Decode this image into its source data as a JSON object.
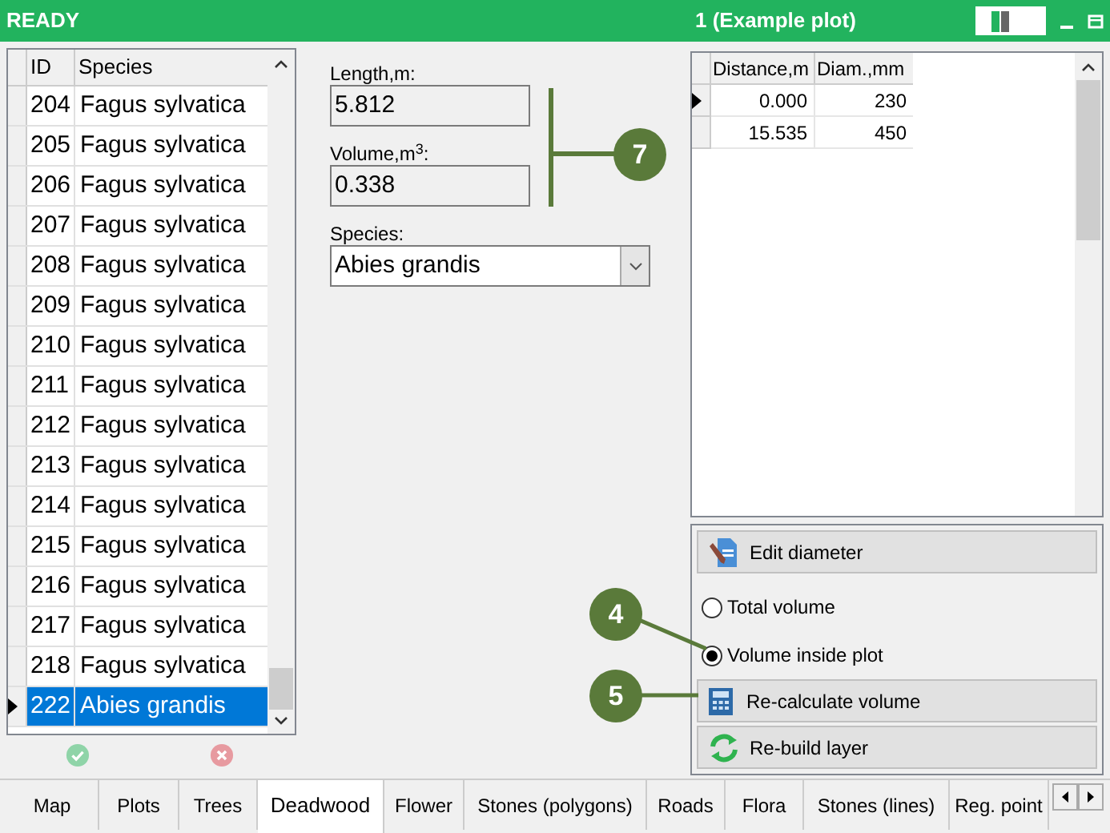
{
  "title_bar": {
    "status": "READY",
    "plot": "1 (Example plot)"
  },
  "species_table": {
    "columns": [
      "ID",
      "Species"
    ],
    "rows": [
      {
        "id": "204",
        "species": "Fagus sylvatica",
        "selected": false
      },
      {
        "id": "205",
        "species": "Fagus sylvatica",
        "selected": false
      },
      {
        "id": "206",
        "species": "Fagus sylvatica",
        "selected": false
      },
      {
        "id": "207",
        "species": "Fagus sylvatica",
        "selected": false
      },
      {
        "id": "208",
        "species": "Fagus sylvatica",
        "selected": false
      },
      {
        "id": "209",
        "species": "Fagus sylvatica",
        "selected": false
      },
      {
        "id": "210",
        "species": "Fagus sylvatica",
        "selected": false
      },
      {
        "id": "211",
        "species": "Fagus sylvatica",
        "selected": false
      },
      {
        "id": "212",
        "species": "Fagus sylvatica",
        "selected": false
      },
      {
        "id": "213",
        "species": "Fagus sylvatica",
        "selected": false
      },
      {
        "id": "214",
        "species": "Fagus sylvatica",
        "selected": false
      },
      {
        "id": "215",
        "species": "Fagus sylvatica",
        "selected": false
      },
      {
        "id": "216",
        "species": "Fagus sylvatica",
        "selected": false
      },
      {
        "id": "217",
        "species": "Fagus sylvatica",
        "selected": false
      },
      {
        "id": "218",
        "species": "Fagus sylvatica",
        "selected": false
      },
      {
        "id": "222",
        "species": "Abies grandis",
        "selected": true
      }
    ]
  },
  "form": {
    "length_label": "Length,m:",
    "length": "5.812",
    "volume_label": "Volume,m$^{3}$:",
    "volume": "0.338",
    "species_label": "Species:",
    "species": "Abies grandis"
  },
  "diameter_table": {
    "columns": [
      "Distance,m",
      "Diam.,mm"
    ],
    "rows": [
      {
        "distance": "0.000",
        "diameter": "230",
        "selected": true
      },
      {
        "distance": "15.535",
        "diameter": "450",
        "selected": false
      }
    ]
  },
  "edit_diameter": "Edit diameter",
  "volume_options": [
    {
      "label": "Total volume",
      "selected": false
    },
    {
      "label": "Volume inside plot",
      "selected": true
    }
  ],
  "recalculate": "Re-calculate volume",
  "rebuild": "Re-build layer",
  "callouts": [
    "7",
    "4",
    "5"
  ],
  "tabs": [
    {
      "label": "Map",
      "selected": false
    },
    {
      "label": "Plots",
      "selected": false
    },
    {
      "label": "Trees",
      "selected": false
    },
    {
      "label": "Deadwood",
      "selected": true
    },
    {
      "label": "Flower",
      "selected": false
    },
    {
      "label": "Stones (polygons)",
      "selected": false
    },
    {
      "label": "Roads",
      "selected": false
    },
    {
      "label": "Flora",
      "selected": false
    },
    {
      "label": "Stones (lines)",
      "selected": false
    },
    {
      "label": "Reg. point",
      "selected": false
    }
  ]
}
